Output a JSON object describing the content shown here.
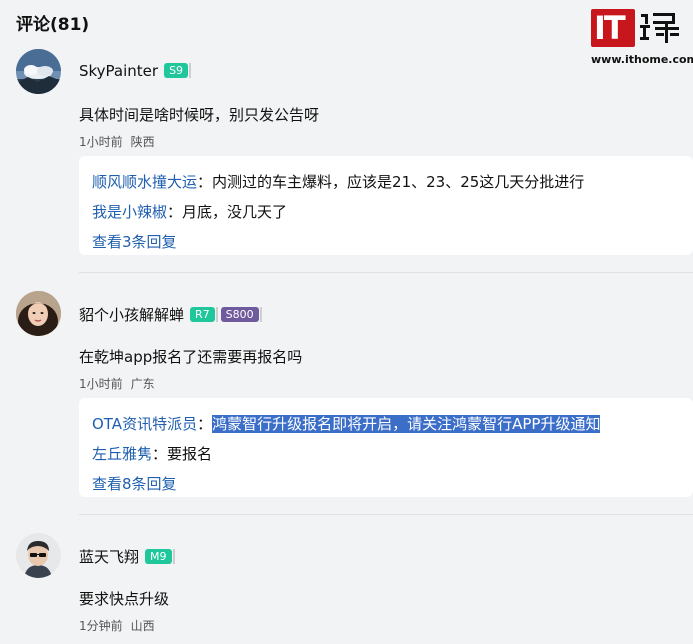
{
  "header": {
    "title": "评论(81)"
  },
  "logo": {
    "text": "IT",
    "url": "www.ithome.com"
  },
  "comments": [
    {
      "username": "SkyPainter",
      "badges": [
        "S9"
      ],
      "text": "具体时间是啥时候呀，别只发公告呀",
      "time": "1小时前",
      "location": "陕西",
      "replies": [
        {
          "name": "顺风顺水撞大运",
          "sep": "：",
          "text": "内测过的车主爆料，应该是21、23、25这几天分批进行"
        },
        {
          "name": "我是小辣椒",
          "sep": "：",
          "text": "月底，没几天了"
        }
      ],
      "more": "查看3条回复"
    },
    {
      "username": "貂个小孩解解蝉",
      "badges": [
        "R7",
        "S800"
      ],
      "text": "在乾坤app报名了还需要再报名吗",
      "time": "1小时前",
      "location": "广东",
      "replies": [
        {
          "name": "OTA资讯特派员",
          "sep": "：",
          "text": "鸿蒙智行升级报名即将开启，请关注鸿蒙智行APP升级通知"
        },
        {
          "name": "左丘雅隽",
          "sep": "：",
          "text": "要报名"
        }
      ],
      "more": "查看8条回复"
    },
    {
      "username": "蓝天飞翔",
      "badges": [
        "M9"
      ],
      "text": "要求快点升级",
      "time": "1分钟前",
      "location": "山西"
    }
  ],
  "colors": {
    "accent": "#1f5fb0",
    "badge_green": "#1fc79b",
    "badge_purple": "#6f5a9e",
    "logo_red": "#c8161d"
  }
}
